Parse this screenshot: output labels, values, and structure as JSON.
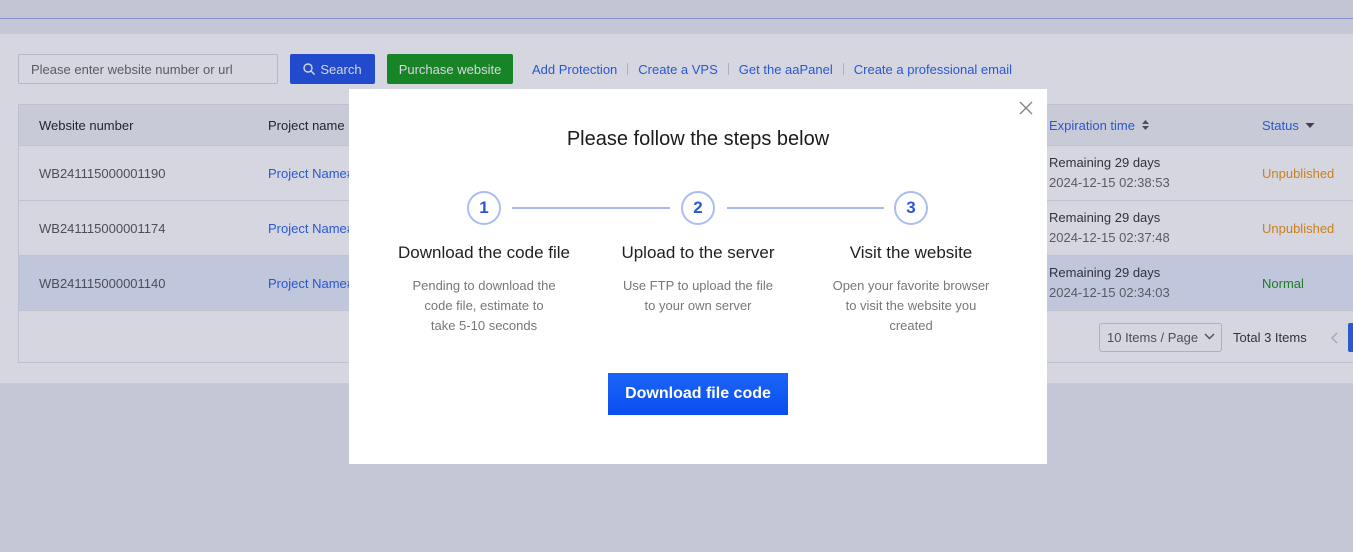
{
  "toolbar": {
    "search_placeholder": "Please enter website number or url",
    "search_label": "Search",
    "purchase_label": "Purchase website",
    "links": [
      "Add Protection",
      "Create a VPS",
      "Get the aaPanel",
      "Create a professional email"
    ]
  },
  "table": {
    "columns": {
      "number": "Website number",
      "project": "Project name",
      "expiration": "Expiration time",
      "status": "Status"
    },
    "rows": [
      {
        "number": "WB241115000001190",
        "project": "Project Name#",
        "remaining": "Remaining 29 days",
        "datetime": "2024-12-15 02:38:53",
        "status": "Unpublished"
      },
      {
        "number": "WB241115000001174",
        "project": "Project Name#",
        "remaining": "Remaining 29 days",
        "datetime": "2024-12-15 02:37:48",
        "status": "Unpublished"
      },
      {
        "number": "WB241115000001140",
        "project": "Project Name#",
        "remaining": "Remaining 29 days",
        "datetime": "2024-12-15 02:34:03",
        "status": "Normal"
      }
    ]
  },
  "pagination": {
    "page_size": "10 Items / Page",
    "total": "Total 3 Items"
  },
  "modal": {
    "title": "Please follow the steps below",
    "steps": [
      {
        "number": "1",
        "title": "Download the code file",
        "description_lines": [
          "Pending to download the",
          "code file, estimate to",
          "take 5-10 seconds"
        ]
      },
      {
        "number": "2",
        "title": "Upload to the server",
        "description_lines": [
          "Use FTP to upload the file",
          "to your own server"
        ]
      },
      {
        "number": "3",
        "title": "Visit the website",
        "description_lines": [
          "Open your favorite browser",
          "to visit the website you",
          "created"
        ]
      }
    ],
    "action_label": "Download file code"
  },
  "icons": {
    "search": "search-icon",
    "close": "close-icon",
    "sort": "sort-icon",
    "filter": "caret-down-icon",
    "select": "chevron-down-icon",
    "prev": "chevron-left-icon"
  },
  "colors": {
    "primary": "#2a62ea",
    "search_button": "#1f51e8",
    "purchase_button": "#129a16",
    "status_unpublished": "#f0960c",
    "status_normal": "#1a9111",
    "step_circle": "#2f56d6"
  }
}
